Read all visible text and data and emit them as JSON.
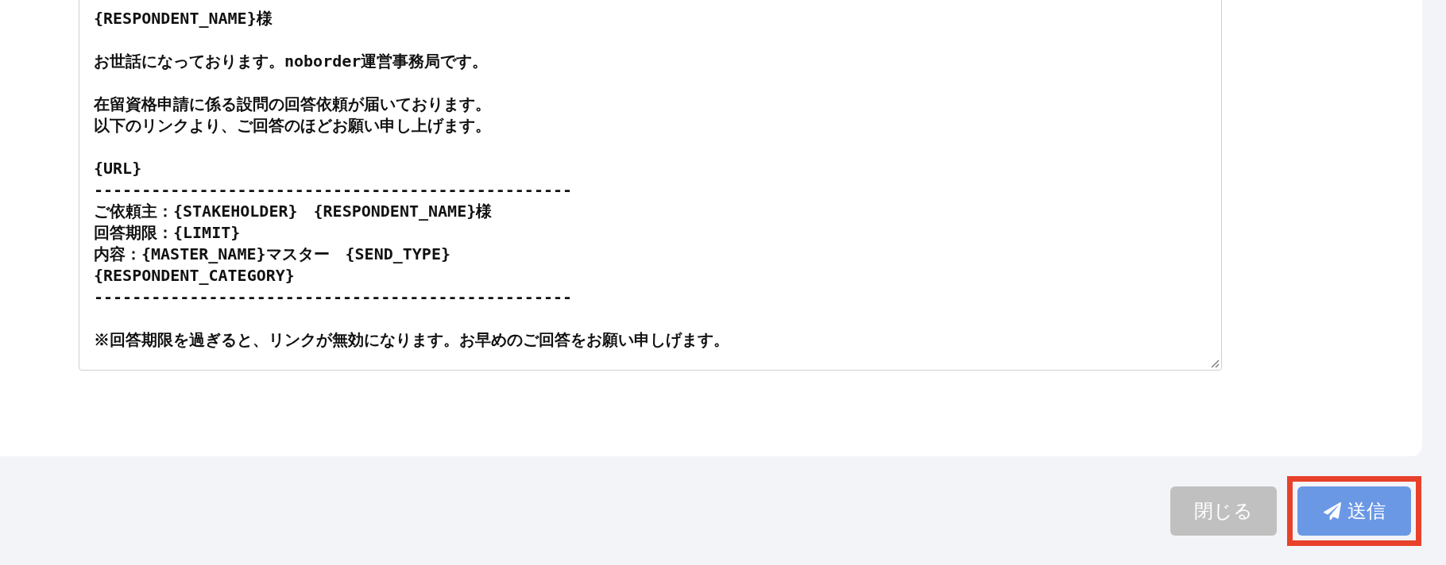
{
  "message_field": {
    "paragraphs": [
      [
        "{RESPONDENT_NAME}様"
      ],
      [
        "お世話になっております。noborder運営事務局です。"
      ],
      [
        "在留資格申請に係る設問の回答依頼が届いております。",
        "以下のリンクより、ご回答のほどお願い申し上げます。"
      ],
      [
        "{URL}",
        "--------------------------------------------------",
        "ご依頼主：{STAKEHOLDER}　{RESPONDENT_NAME}様",
        "回答期限：{LIMIT}",
        "内容：{MASTER_NAME}マスター　{SEND_TYPE}",
        "{RESPONDENT_CATEGORY}",
        "--------------------------------------------------"
      ],
      [
        "※回答期限を過ぎると、リンクが無効になります。お早めのご回答をお願い申しげます。"
      ]
    ]
  },
  "buttons": [
    {
      "kind": "close",
      "label": "閉じる",
      "highlighted": false
    },
    {
      "kind": "send",
      "label": "送信",
      "highlighted": true
    }
  ]
}
